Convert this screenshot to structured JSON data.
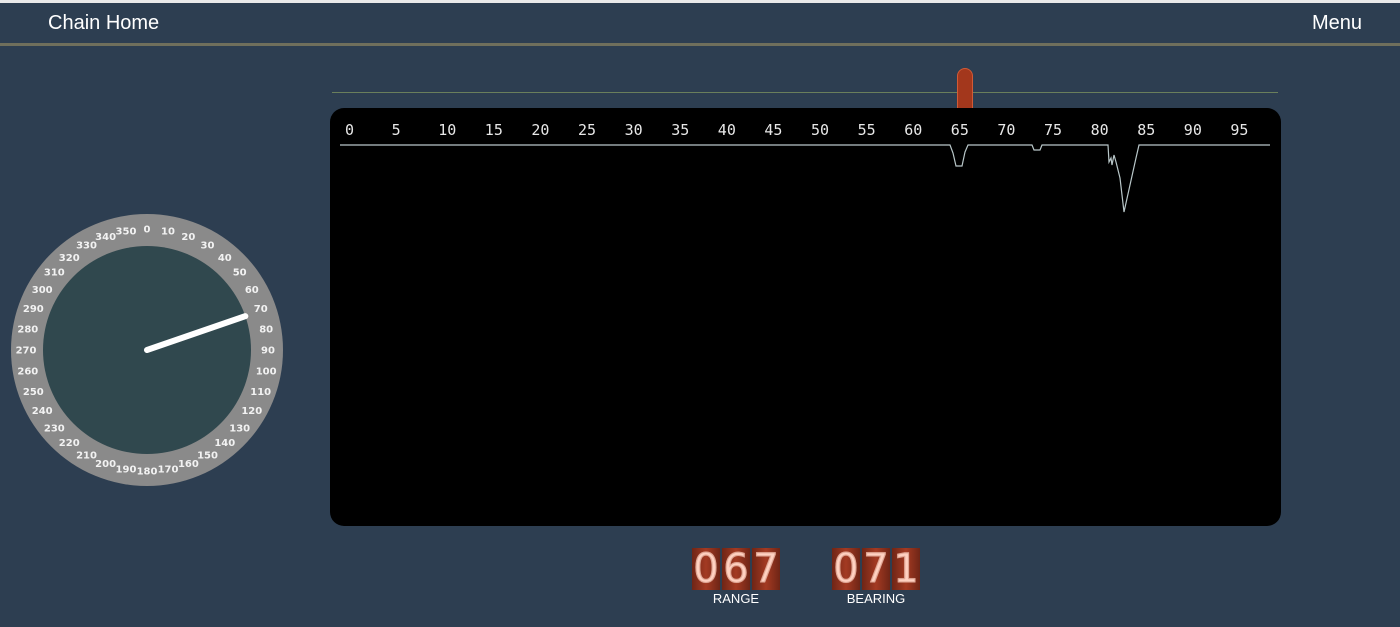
{
  "header": {
    "title": "Chain Home",
    "menu_label": "Menu"
  },
  "range_slider": {
    "value": 67,
    "min": 0,
    "max": 100
  },
  "scope": {
    "scale_labels": [
      "0",
      "5",
      "10",
      "15",
      "20",
      "25",
      "30",
      "35",
      "40",
      "45",
      "50",
      "55",
      "60",
      "65",
      "70",
      "75",
      "80",
      "85",
      "90",
      "95"
    ],
    "trace_color": "#b9c7c9"
  },
  "goniometer": {
    "bearing": 71,
    "labels": [
      "0",
      "10",
      "20",
      "30",
      "40",
      "50",
      "60",
      "70",
      "80",
      "90",
      "100",
      "110",
      "120",
      "130",
      "140",
      "150",
      "160",
      "170",
      "180",
      "190",
      "200",
      "210",
      "220",
      "230",
      "240",
      "250",
      "260",
      "270",
      "280",
      "290",
      "300",
      "310",
      "320",
      "330",
      "340",
      "350"
    ]
  },
  "readouts": {
    "range": {
      "digits": [
        "0",
        "6",
        "7"
      ],
      "label": "RANGE"
    },
    "bearing": {
      "digits": [
        "0",
        "7",
        "1"
      ],
      "label": "BEARING"
    }
  },
  "colors": {
    "background": "#2d3e51",
    "accent": "#a3371c",
    "dial_ring": "#8a8a8a",
    "dial_face": "#30484e"
  }
}
